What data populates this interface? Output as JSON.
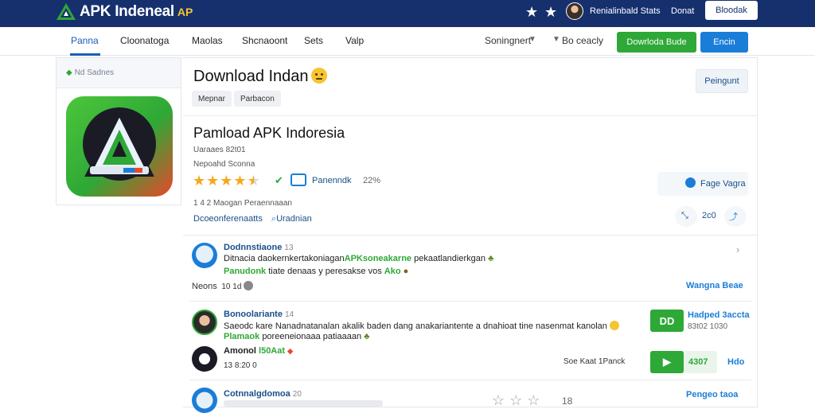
{
  "header": {
    "logo_text": "APK Indeneal",
    "logo_badge": "AP",
    "user_name": "Renialinbald Stats",
    "donate_label": "Donat",
    "account_button": "Bloodak"
  },
  "nav": {
    "items": [
      "Panna",
      "Cloonatoga",
      "Maolas",
      "Shcnaoont",
      "Sets",
      "Valp"
    ],
    "active_index": 0,
    "sort_label": "Soningnert",
    "go_label": "Bo ceacly",
    "download_button": "Dowrloda Bude",
    "login_button": "Encin"
  },
  "left_card": {
    "header_label": "Nd Sadnes",
    "icon_name": "apk-indonesia-app-icon"
  },
  "app": {
    "title": "Download Indan",
    "tags": [
      "Mepnar",
      "Parbacon"
    ],
    "secondary_button": "Peingunt",
    "name": "Pamload APK Indoresia",
    "meta_1": "Uaraaes 82t01",
    "meta_2": "Nepoahd Sconna",
    "rating_value": 4.5,
    "badge_label": "Panenndk",
    "badge_count": "22%",
    "side_link_1": "Fage Vagra",
    "rating_count": "1 4 2  Maogan Peraennaaan",
    "link_1": "Dcoeonferenaatts",
    "link_2": "Uradnian",
    "side_count": "2c0"
  },
  "comments": [
    {
      "name": "Dodnnstiaone",
      "num": "13",
      "line1": "Ditnacia daokernkertakoniagan",
      "line1_green": "APKsoneakarne",
      "line1_rest": "pekaatlandierkgan",
      "line2_green": "Panudonk",
      "line2_rest": "tiate denaas y peresakse vos",
      "line2_tail": "Ako",
      "foot_label": "Neons",
      "foot_num": "10 1d",
      "reply": "Wangna Beae"
    },
    {
      "name": "Bonoolariante",
      "num": "14",
      "line1": "Saeodc kare Nanadnatanalan akalik baden dang anakariantente a dnahioat tine nasenmat kanolan",
      "line2_green": "Plamaok",
      "line2_rest": "poreeneionaaa patiaaaan",
      "tile_label": "DD",
      "side_link": "Hadped 3accta",
      "side_num": "83t02 1030"
    },
    {
      "name": "Amonol",
      "name_green": "l50Aat",
      "foot_num": "13 8:20 0",
      "mid_label": "Soe Kaat 1Panck",
      "tile_label": "4307",
      "side_link": "Hdo"
    },
    {
      "name": "Cotnnalgdomoa",
      "num": "20",
      "rating_count": "18",
      "side_link": "Pengeo taoa"
    }
  ],
  "colors": {
    "header_bg": "#16306e",
    "accent_blue": "#1a7ed8",
    "accent_green": "#2ea836",
    "star": "#f4a81c"
  }
}
